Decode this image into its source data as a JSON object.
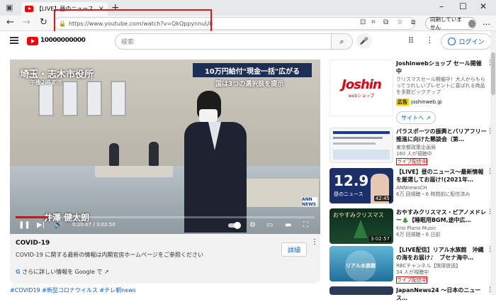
{
  "browser": {
    "tab_title": "【LIVE】昼のニュース 最新情報",
    "address": "https://www.youtube.com/watch?v=QkQppynnuU8",
    "sync_label": "同期していません"
  },
  "youtube": {
    "logo_suffix": "10000000000",
    "search_placeholder": "検索",
    "login_label": "ログイン"
  },
  "video": {
    "location": "埼玉・志木市役所",
    "time": "午後2時すぎ",
    "headline": "10万円給付\"現金一括\"広がる",
    "subline": "国は3つの選択肢を提示",
    "anchor": "井澤 健太朗",
    "timecode": "0:20:07 / 3:02:50",
    "progress_fraction": 0.11,
    "channel_mark": "ANN NEWS"
  },
  "info": {
    "title": "COVID-19",
    "description": "COVID-19 に関する最新の情報は内閣官房ホームページをご参照ください",
    "detail_button": "詳細",
    "google_link": "さらに詳しい情報を Google で",
    "hashtags": "#COVID19 #新型コロナウイルス #テレ朝news"
  },
  "ad": {
    "logo": "Joshin",
    "logo_sub": "webショップ",
    "title": "Joshinwebショップ セール開催中",
    "desc": "クリスマスセール開催中！大人からもらってうれしいプレゼントに喜ばれる商品を多数ピックアップ",
    "badge": "広告",
    "domain": "joshinweb.jp",
    "site_button": "サイトへ"
  },
  "recommendations": [
    {
      "title": "パラスポーツの振興とバリアフリー推進に向けた懇談会（第…",
      "channel": "東京都政策企画局",
      "meta": "160 人が視聴中",
      "live": "ライブ配信中",
      "duration": ""
    },
    {
      "title": "【LIVE】昼のニュース～最新情報を厳選してお届け!(2021年…",
      "channel": "ANNnewsCH",
      "meta": "6万 回視聴・6 時間前に配信済み",
      "live": "",
      "duration": "42:45"
    },
    {
      "title": "おやすみクリスマス・ピアノメドレー🎄【睡眠用BGM,途中広…",
      "channel": "Kno Piano Music",
      "meta": "6万 回視聴・6 日前",
      "live": "",
      "duration": "3:02:57"
    },
    {
      "title": "【LIVE配信】リアル水族館　沖縄の海をお届け♪　ブセナ海中…",
      "channel": "RBCチャンネル【琉球放送】",
      "meta": "34 人が視聴中",
      "live": "ライブ配信中",
      "duration": ""
    },
    {
      "title": "JapanNews24 ～日本のニュース…",
      "channel": "",
      "meta": "",
      "live": "",
      "duration": ""
    }
  ],
  "thumb_labels": {
    "t2_big": "12.9",
    "t2_small": "昼のニュース",
    "t3_text": "おやすみクリスマス",
    "t4_text": "リアル水族館"
  }
}
